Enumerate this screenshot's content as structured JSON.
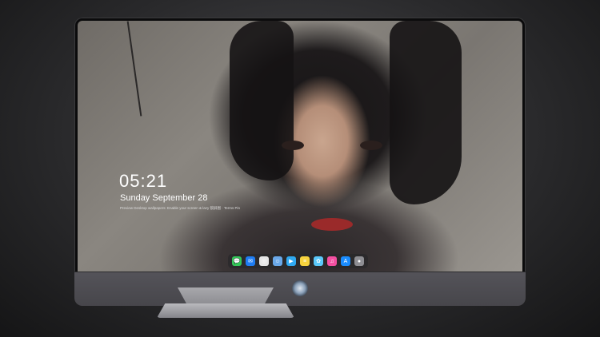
{
  "lockscreen": {
    "time": "05:21",
    "date": "Sunday September  28",
    "tip": "Preview Desktop wallpapers: Enable your screen & lazy 锁屏图 · Terms  Pin"
  },
  "dock": {
    "apps": [
      {
        "name": "messages",
        "glyph": "💬",
        "color": "#34c759"
      },
      {
        "name": "mail",
        "glyph": "✉",
        "color": "#1e7cf2"
      },
      {
        "name": "safari",
        "glyph": "◎",
        "color": "#e6e6e6"
      },
      {
        "name": "finder",
        "glyph": "☺",
        "color": "#6aa8e8"
      },
      {
        "name": "clips",
        "glyph": "▶",
        "color": "#2fa8f0"
      },
      {
        "name": "notes",
        "glyph": "≡",
        "color": "#f7d33e"
      },
      {
        "name": "photos",
        "glyph": "✿",
        "color": "#5ac8fa"
      },
      {
        "name": "itunes",
        "glyph": "♫",
        "color": "#f34fa1"
      },
      {
        "name": "app-store",
        "glyph": "A",
        "color": "#1a8cff"
      },
      {
        "name": "camera",
        "glyph": "●",
        "color": "#8e8e93"
      }
    ]
  }
}
